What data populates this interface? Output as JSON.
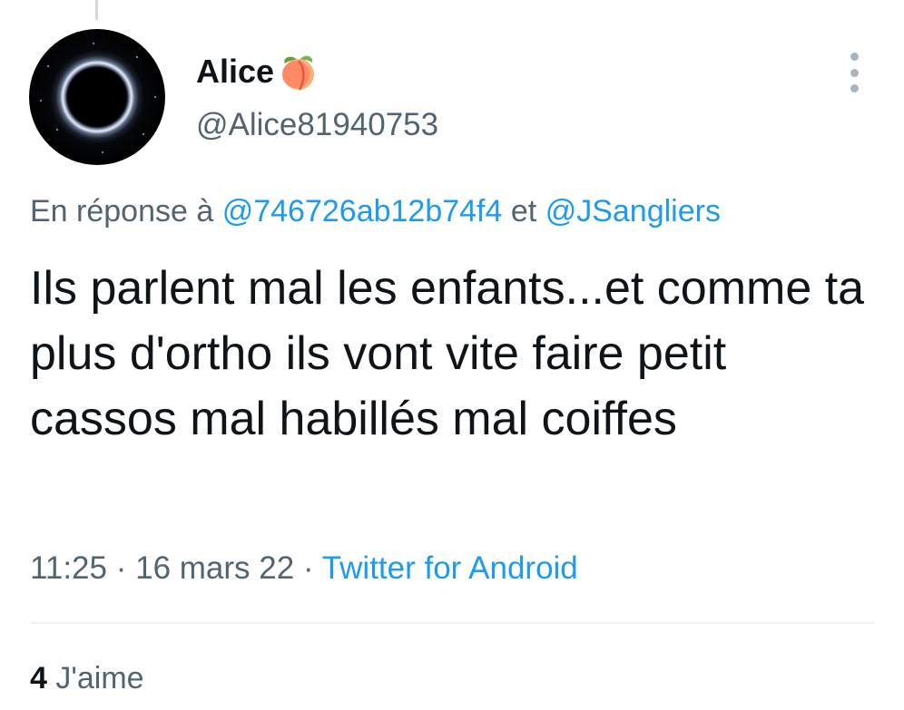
{
  "author": {
    "display_name": "Alice",
    "handle": "@Alice81940753",
    "name_emoji_icon": "peach-icon"
  },
  "reply": {
    "prefix": "En réponse à",
    "mention_1": "@746726ab12b74f4",
    "conjunction": "et",
    "mention_2": "@JSangliers"
  },
  "tweet": {
    "text": "Ils parlent mal les enfants...et comme ta plus d'ortho ils vont vite faire petit cassos mal habillés mal coiffes",
    "time": "11:25",
    "separator": "·",
    "date": "16 mars 22",
    "source": "Twitter for Android"
  },
  "stats": {
    "likes_count": "4",
    "likes_label": "J'aime"
  },
  "colors": {
    "link": "#1d9bf0",
    "secondary_text": "#536471",
    "primary_text": "#0f1419"
  }
}
